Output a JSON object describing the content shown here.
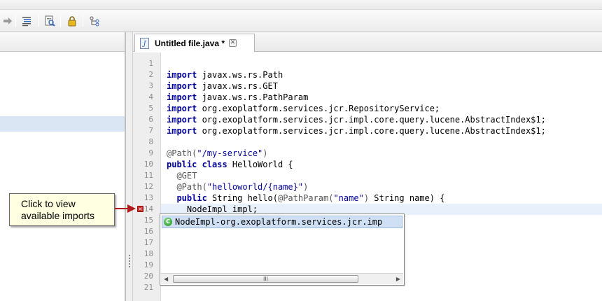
{
  "toolbar": {
    "icons": [
      "arrow-right-icon",
      "format-icon",
      "preview-icon",
      "lock-icon",
      "outline-icon"
    ]
  },
  "tab": {
    "label": "Untitled file.java *",
    "file_icon_glyph": "J"
  },
  "editor": {
    "line_numbers": [
      "1",
      "2",
      "3",
      "4",
      "5",
      "6",
      "7",
      "8",
      "9",
      "10",
      "11",
      "12",
      "13",
      "14",
      "15",
      "16",
      "17",
      "18",
      "19",
      "20",
      "21"
    ],
    "current_line": 14,
    "error_line": 14
  },
  "popup": {
    "suggestion": "NodeImpl-org.exoplatform.services.jcr.imp",
    "scroll_glyph": "III"
  },
  "callout": {
    "line1": "Click to view",
    "line2": "available imports"
  },
  "colors": {
    "keyword": "#000099",
    "error": "#d32222",
    "callout_bg": "#ffffe1",
    "selection": "#cfe0f5"
  }
}
